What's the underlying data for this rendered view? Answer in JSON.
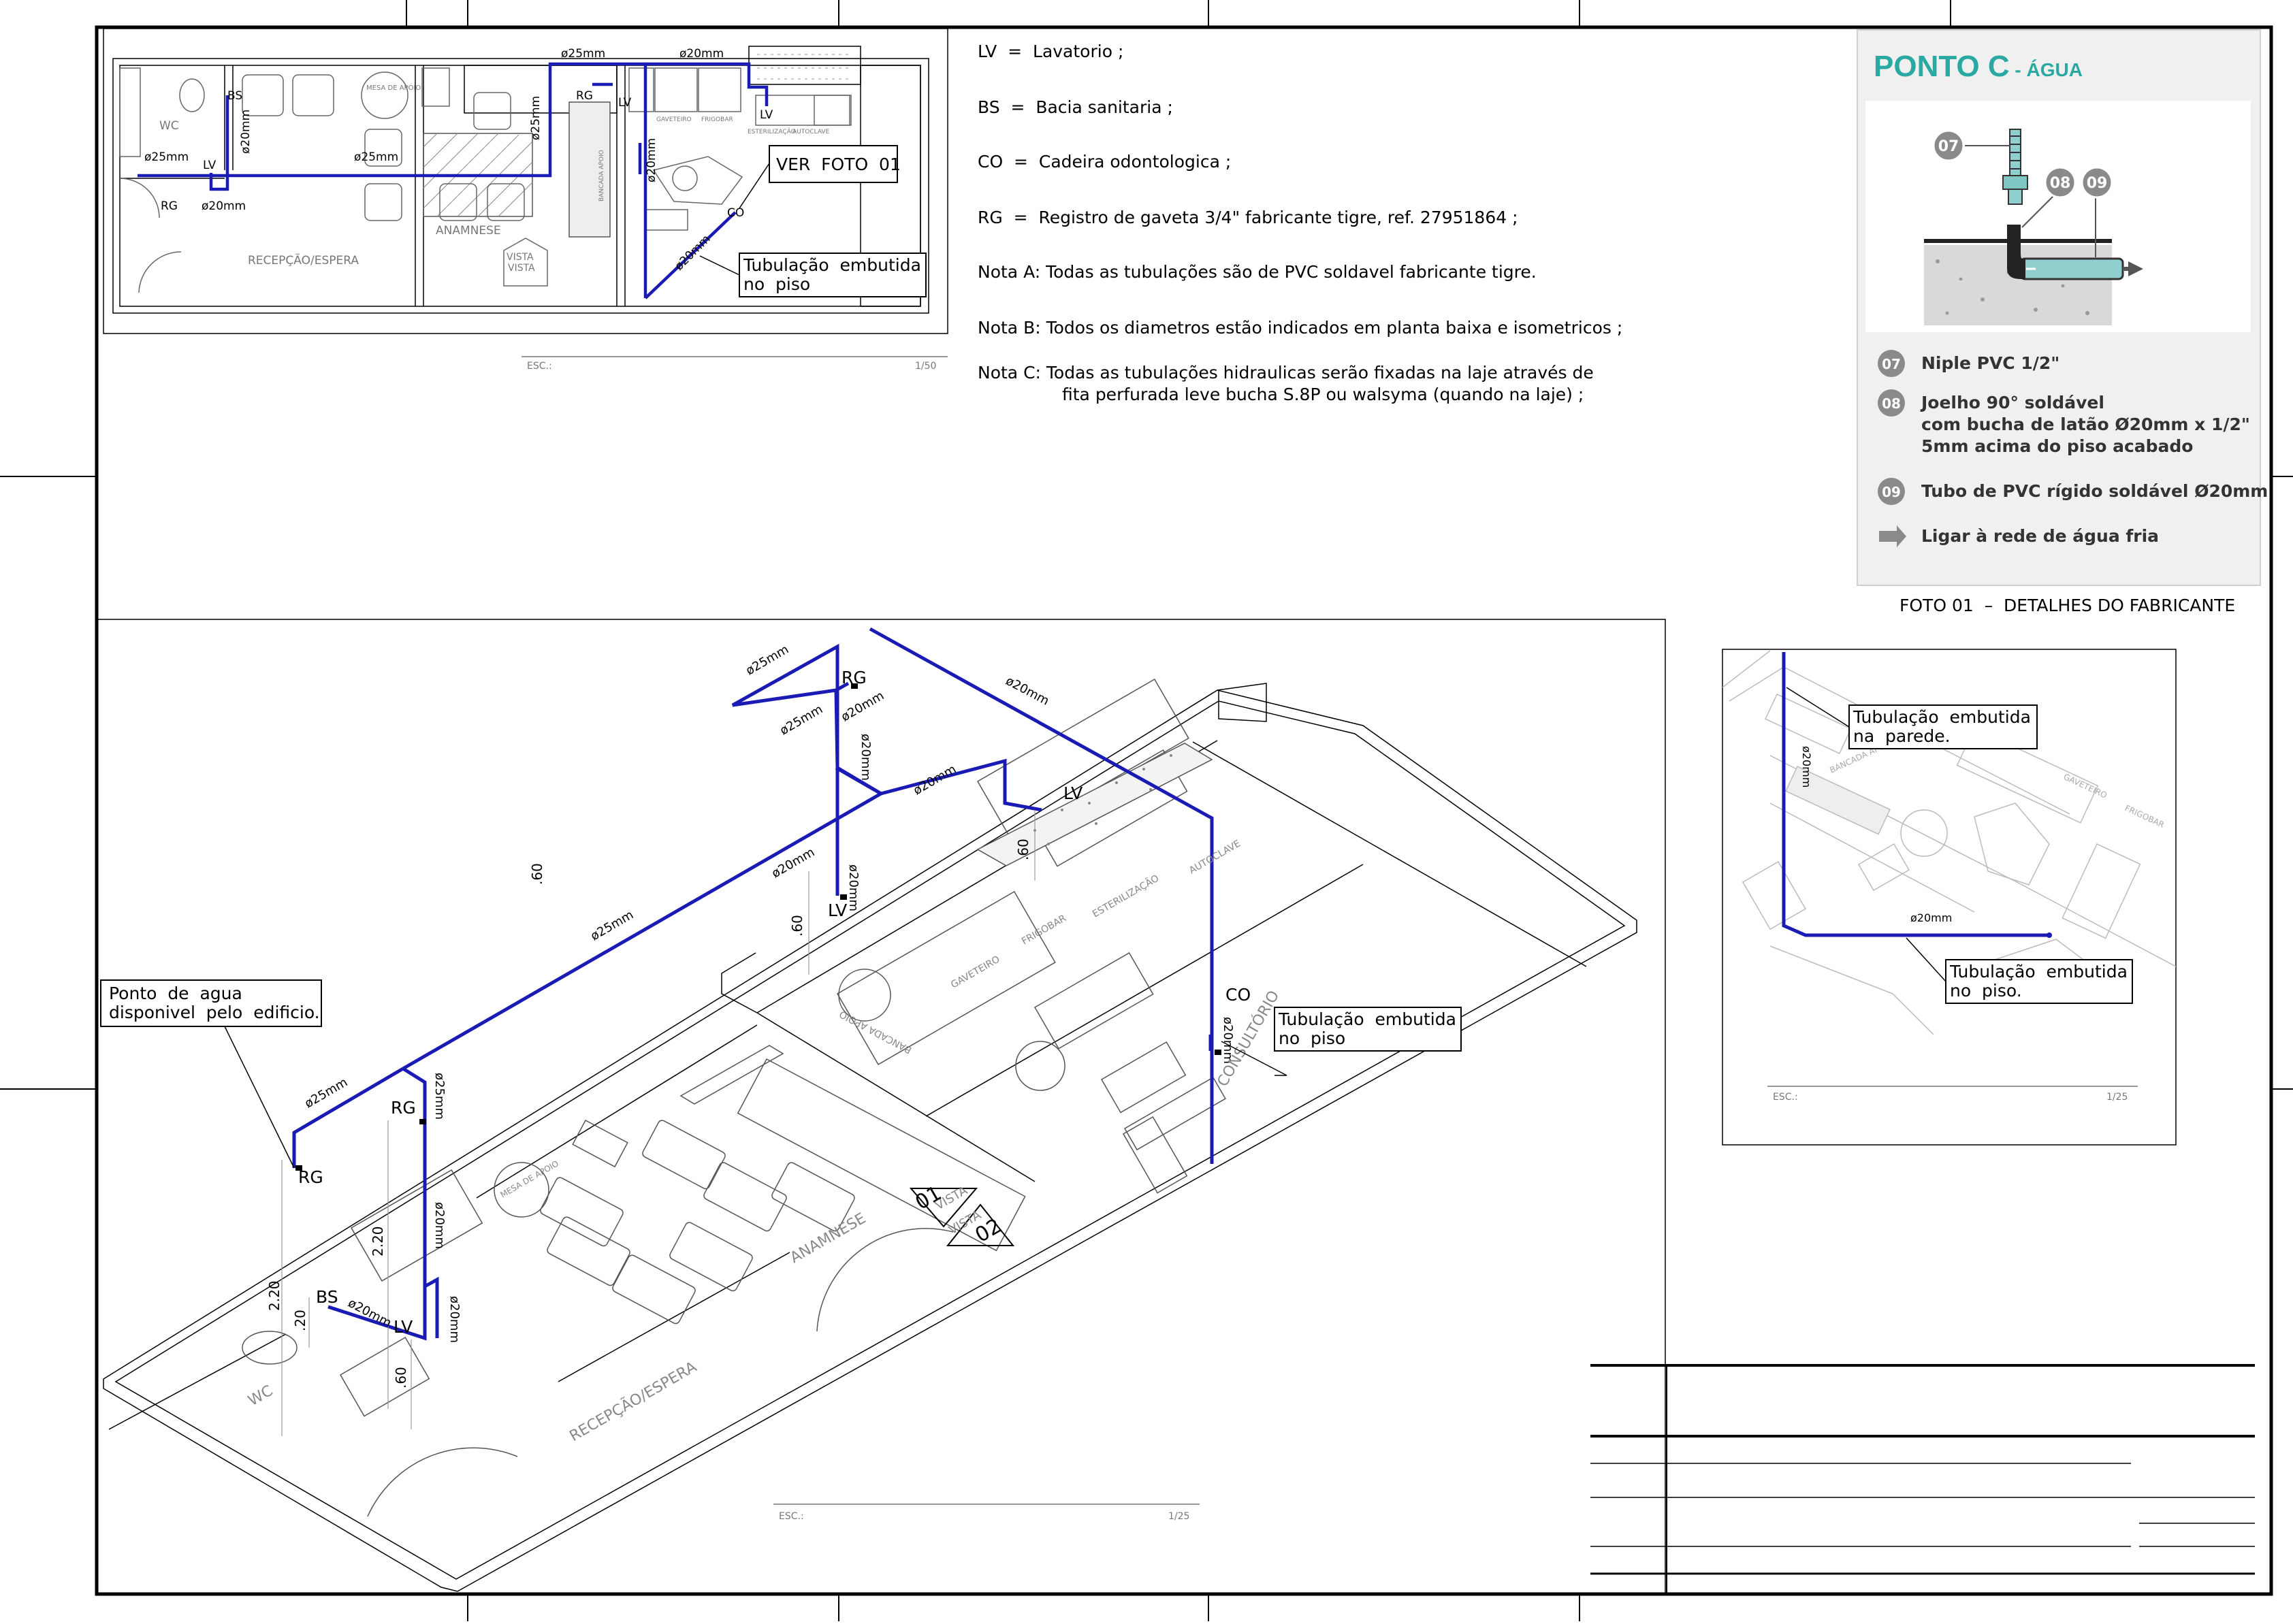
{
  "colors": {
    "pipe": "#1a1ab4",
    "line": "#000000",
    "light": "#9a9a9a",
    "teal": "#2aa9a3",
    "photo_bg": "#f0f0f0",
    "legend_circle": "#8a8a8a"
  },
  "legend": [
    "LV  =  Lavatorio ;",
    "BS  =  Bacia sanitaria ;",
    "CO  =  Cadeira odontologica ;",
    "RG  =  Registro de gaveta 3/4\" fabricante tigre, ref. 27951864 ;",
    "Nota A: Todas as tubulações são de PVC soldavel fabricante tigre.",
    "Nota B: Todos os diametros estão indicados em planta baixa e isometricos ;",
    "Nota C: Todas as tubulações hidraulicas serão fixadas na laje através de",
    "fita perfurada leve bucha S.8P ou walsyma (quando na laje) ;"
  ],
  "photo": {
    "title": "PONTO C",
    "title_suffix": " - ÁGUA",
    "items": [
      {
        "num": "07",
        "text": "Niple PVC 1/2\""
      },
      {
        "num": "08",
        "text": "Joelho 90° soldável"
      },
      {
        "num": "",
        "text": "com bucha de latão Ø20mm x 1/2\""
      },
      {
        "num": "",
        "text": "5mm acima do piso acabado"
      },
      {
        "num": "09",
        "text": "Tubo de PVC rígido soldável Ø20mm"
      },
      {
        "num": "",
        "text": "Ligar à rede de água fria"
      }
    ],
    "caption": "FOTO 01  –  DETALHES DO FABRICANTE"
  },
  "plan": {
    "rooms": [
      "WC",
      "BS",
      "LV",
      "RG",
      "MESA DE APOIO",
      "ANAMNESE",
      "RECEPÇÃO/ESPERA",
      "VISTA",
      "VISTA",
      "CO",
      "LV",
      "LV",
      "RG"
    ],
    "dims": [
      "ø25mm",
      "ø20mm",
      "ø25mm",
      "ø20mm",
      "ø25mm",
      "ø20mm",
      "ø25mm",
      "ø20mm",
      "ø20mm"
    ],
    "equip": [
      "GAVETEIRO",
      "FRIGOBAR",
      "ESTERILIZAÇÃO",
      "AUTOCLAVE",
      "BANCADA APOIO"
    ],
    "callout1": "VER  FOTO  01",
    "callout2a": "Tubulação  embutida",
    "callout2b": "no  piso",
    "scale_label": "ESC.:",
    "scale": "1/50"
  },
  "iso": {
    "labels": [
      "RG",
      "RG",
      "LV",
      "LV",
      "BS",
      "LV",
      "CO",
      "RG"
    ],
    "dims": [
      "ø25mm",
      "ø25mm",
      "ø20mm",
      "ø20mm",
      "ø20mm",
      "ø20mm",
      "ø25mm",
      "ø25mm",
      "ø25mm",
      "ø20mm",
      "ø20mm",
      "ø20mm",
      "ø20mm",
      "ø20mm",
      "ø20mm"
    ],
    "heights": [
      ".60",
      ".60",
      ".60",
      "2.20",
      "2.20",
      ".20",
      ".60"
    ],
    "rooms": [
      "WC",
      "RECEPÇÃO/ESPERA",
      "ANAMNESE",
      "MESA DE APOIO",
      "CONSULTÓRIO",
      "GAVETEIRO",
      "FRIGOBAR",
      "ESTERILIZAÇÃO",
      "AUTOCLAVE",
      "BANCADA APOIO",
      "VISTA",
      "VISTA",
      "01",
      "02"
    ],
    "callout_water_a": "Ponto  de  agua",
    "callout_water_b": "disponivel  pelo  edificio.",
    "callout_floor_a": "Tubulação  embutida",
    "callout_floor_b": "no  piso",
    "scale_label": "ESC.:",
    "scale": "1/25"
  },
  "detail": {
    "callout_wall_a": "Tubulação  embutida",
    "callout_wall_b": "na  parede.",
    "callout_floor_a": "Tubulação  embutida",
    "callout_floor_b": "no  piso.",
    "dim1": "ø20mm",
    "dim2": "ø20mm",
    "rooms": [
      "BANCADA APOIO",
      "GAVETEIRO",
      "FRIGOBAR"
    ],
    "scale_label": "ESC.:",
    "scale": "1/25"
  }
}
